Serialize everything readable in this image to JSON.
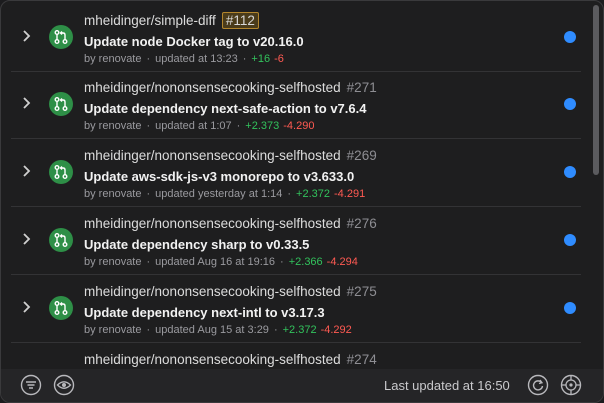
{
  "items": [
    {
      "repo": "mheidinger/simple-diff",
      "number": "#112",
      "highlighted": true,
      "title": "Update node Docker tag to v20.16.0",
      "author": "by renovate",
      "updated": "updated at 13:23",
      "additions": "+16",
      "deletions": "-6"
    },
    {
      "repo": "mheidinger/nononsensecooking-selfhosted",
      "number": "#271",
      "highlighted": false,
      "title": "Update dependency next-safe-action to v7.6.4",
      "author": "by renovate",
      "updated": "updated at 1:07",
      "additions": "+2.373",
      "deletions": "-4.290"
    },
    {
      "repo": "mheidinger/nononsensecooking-selfhosted",
      "number": "#269",
      "highlighted": false,
      "title": "Update aws-sdk-js-v3 monorepo to v3.633.0",
      "author": "by renovate",
      "updated": "updated yesterday at 1:14",
      "additions": "+2.372",
      "deletions": "-4.291"
    },
    {
      "repo": "mheidinger/nononsensecooking-selfhosted",
      "number": "#276",
      "highlighted": false,
      "title": "Update dependency sharp to v0.33.5",
      "author": "by renovate",
      "updated": "updated Aug 16 at 19:16",
      "additions": "+2.366",
      "deletions": "-4.294"
    },
    {
      "repo": "mheidinger/nononsensecooking-selfhosted",
      "number": "#275",
      "highlighted": false,
      "title": "Update dependency next-intl to v3.17.3",
      "author": "by renovate",
      "updated": "updated Aug 15 at 3:29",
      "additions": "+2.372",
      "deletions": "-4.292"
    },
    {
      "repo": "mheidinger/nononsensecooking-selfhosted",
      "number": "#274",
      "highlighted": false,
      "title": "",
      "author": "",
      "updated": "",
      "additions": "",
      "deletions": ""
    }
  ],
  "footer": {
    "status": "Last updated at 16:50",
    "icons": [
      "filter-icon",
      "eye-icon",
      "refresh-icon",
      "settings-icon"
    ]
  },
  "colors": {
    "unread": "#2f8cff",
    "pr_open": "#2e8f47",
    "additions": "#32c25c",
    "deletions": "#ff5a52",
    "highlight": "#b3862d"
  }
}
